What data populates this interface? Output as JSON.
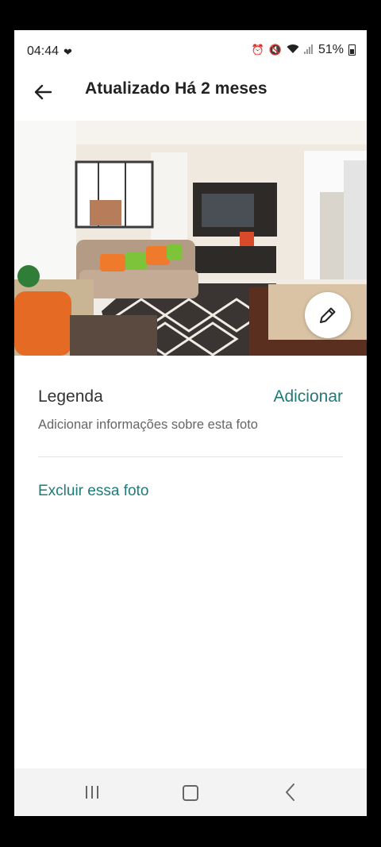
{
  "status_bar": {
    "time": "04:44",
    "battery": "51%"
  },
  "app_bar": {
    "title": "Atualizado Há 2 meses",
    "back_icon": "arrow-left-icon"
  },
  "photo": {
    "description_icon": "edit-pencil-icon"
  },
  "caption": {
    "label": "Legenda",
    "action": "Adicionar",
    "hint": "Adicionar informações sobre esta foto"
  },
  "actions": {
    "delete": "Excluir essa foto"
  },
  "colors": {
    "accent": "#1f7a78"
  }
}
